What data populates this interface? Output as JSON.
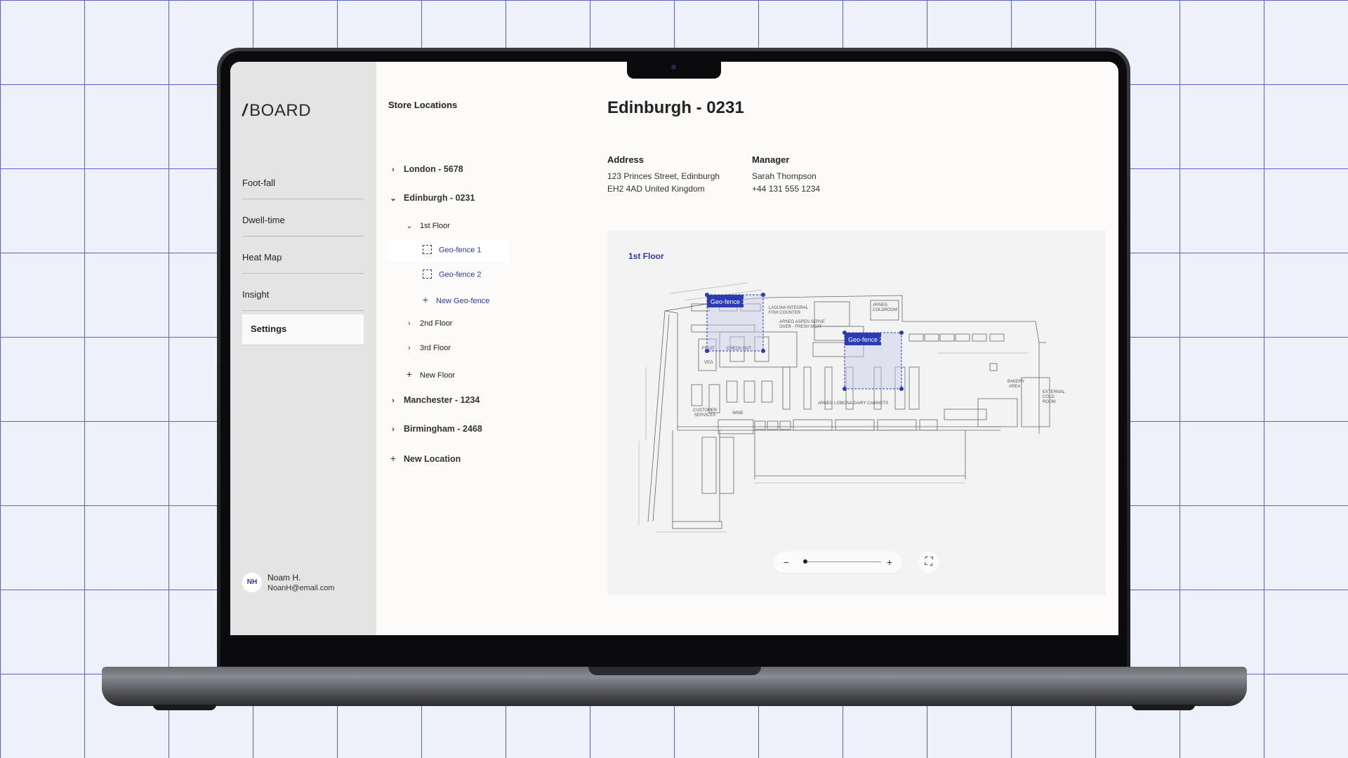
{
  "sidebar": {
    "logo_slash": "/",
    "logo_text": "BOARD",
    "nav": [
      "Foot-fall",
      "Dwell-time",
      "Heat Map",
      "Insight",
      "Settings"
    ],
    "active": "Settings",
    "user": {
      "initials": "NH",
      "name": "Noam H.",
      "email": "NoanH@email.com"
    }
  },
  "locations": {
    "title": "Store Locations",
    "london": "London - 5678",
    "edinburgh": "Edinburgh - 0231",
    "floor1": "1st Floor",
    "geofence1": "Geo-fence 1",
    "geofence2": "Geo-fence 2",
    "new_geofence": "New Geo-fence",
    "floor2": "2nd Floor",
    "floor3": "3rd Floor",
    "new_floor": "New Floor",
    "manchester": "Manchester - 1234",
    "birmingham": "Birmingham - 2468",
    "new_location": "New Location"
  },
  "store": {
    "title": "Edinburgh - 0231",
    "address_label": "Address",
    "address_line1": "123 Princes Street, Edinburgh",
    "address_line2": "EH2 4AD United Kingdom",
    "manager_label": "Manager",
    "manager_name": "Sarah Thompson",
    "manager_phone": "+44 131 555 1234"
  },
  "map": {
    "floor_label": "1st Floor",
    "geofence1_label": "Geo-fence 1",
    "geofence2_label": "Geo-fence 2",
    "zoom_level": 0.0,
    "plan_labels": {
      "checkout": "CHECK OUT",
      "fruit": "FRUIT",
      "veg": "VEG",
      "laguna": "LAGUNA INTEGRAL",
      "fish_counter": "FISH COUNTER",
      "aspen": "ARNEG ASPEN SERVE",
      "aspen2": "OVER - FRESH MEAT",
      "coldroom": "ARNEG",
      "coldroom2": "COLDROOM",
      "customer": "CUSTOMER",
      "services": "SERVICES",
      "wine": "WINE",
      "lisboa": "ARNEG LISBONA DAIRY CABINETS",
      "bakery": "BAKERY",
      "bakery2": "AREA",
      "external": "EXTERNAL",
      "external2": "COLD",
      "external3": "ROOM"
    },
    "accent": "#2b3bb5"
  }
}
